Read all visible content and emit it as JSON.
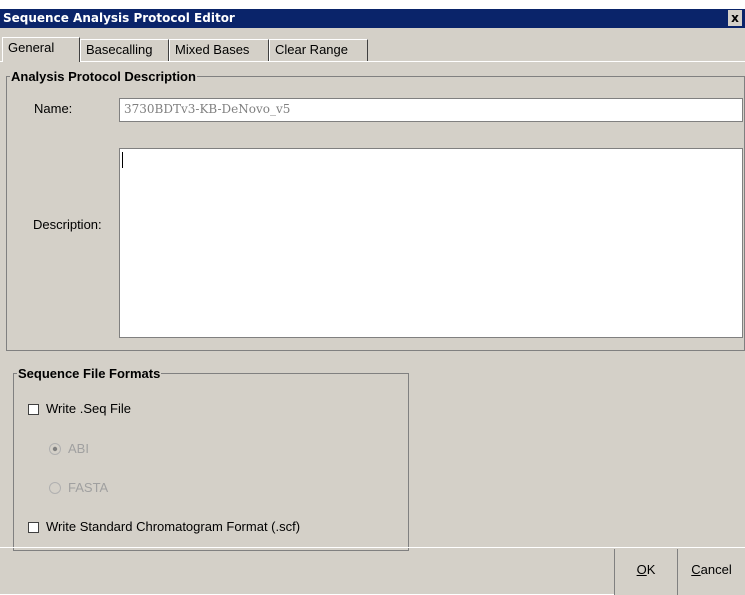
{
  "window": {
    "title": "Sequence Analysis Protocol Editor",
    "close_glyph": "x"
  },
  "tabs": [
    {
      "label": "General",
      "active": true
    },
    {
      "label": "Basecalling",
      "active": false
    },
    {
      "label": "Mixed Bases",
      "active": false
    },
    {
      "label": "Clear Range",
      "active": false
    }
  ],
  "description_group": {
    "legend": "Analysis Protocol Description",
    "name_label": "Name:",
    "name_value": "3730BDTv3-KB-DeNovo_v5",
    "description_label": "Description:",
    "description_value": ""
  },
  "file_formats_group": {
    "legend": "Sequence File Formats",
    "write_seq_label": "Write .Seq File",
    "write_seq_checked": false,
    "format_options": [
      {
        "label": "ABI",
        "selected": true,
        "enabled": false
      },
      {
        "label": "FASTA",
        "selected": false,
        "enabled": false
      }
    ],
    "write_scf_label": "Write Standard Chromatogram Format (.scf)",
    "write_scf_checked": false
  },
  "buttons": {
    "ok_mnemonic": "O",
    "ok_rest": "K",
    "cancel_mnemonic": "C",
    "cancel_rest": "ancel"
  },
  "colors": {
    "titlebar": "#0a246a",
    "dialog_bg": "#d4d0c8"
  },
  "icons": {
    "close": "close-icon",
    "radio": "radio-icon",
    "checkbox": "checkbox-icon"
  }
}
